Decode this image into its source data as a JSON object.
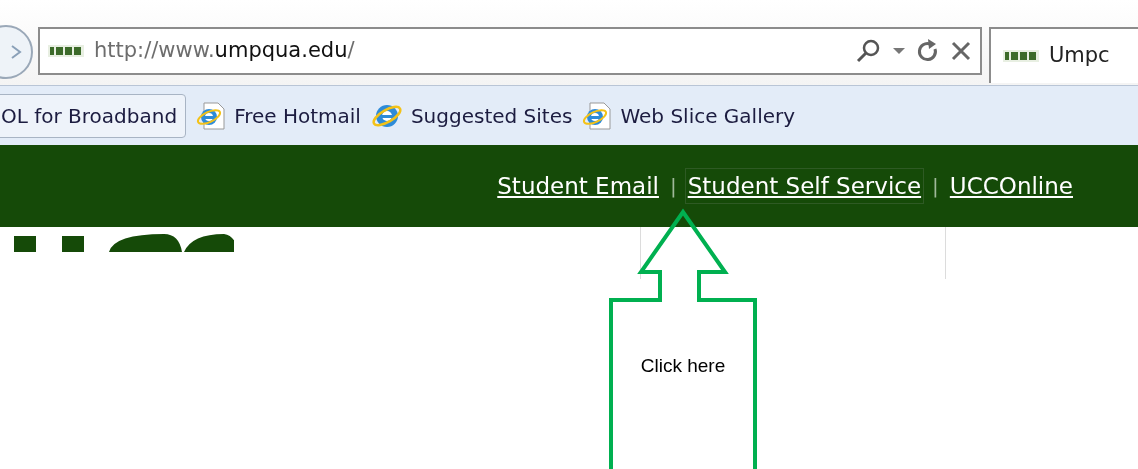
{
  "address_bar": {
    "url_prefix": "http://www.",
    "url_domain": "umpqua.edu",
    "url_suffix": "/"
  },
  "tab": {
    "title": "Umpc"
  },
  "favorites": [
    {
      "label": "OL for Broadband",
      "kind": "button"
    },
    {
      "label": "Free Hotmail",
      "kind": "page"
    },
    {
      "label": "Suggested Sites",
      "kind": "globe"
    },
    {
      "label": "Web Slice Gallery",
      "kind": "page"
    }
  ],
  "header_links": [
    {
      "label": "Student Email",
      "selected": false
    },
    {
      "label": "Student Self Service",
      "selected": true
    },
    {
      "label": "UCCOnline",
      "selected": false
    }
  ],
  "separator": "|",
  "callout": {
    "text": "Click here"
  }
}
